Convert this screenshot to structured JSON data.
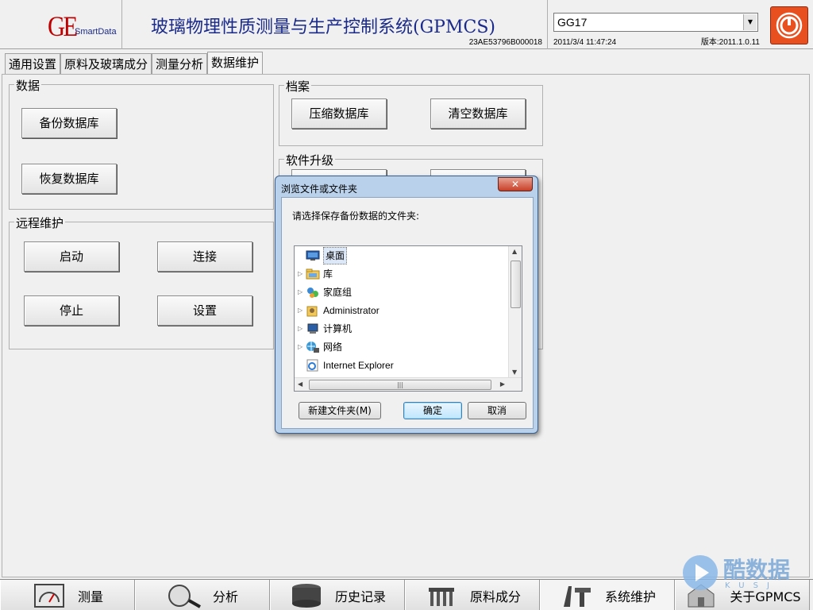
{
  "header": {
    "logo_main": "GE",
    "logo_sub": "SmartData",
    "title": "玻璃物理性质测量与生产控制系统(GPMCS)",
    "serial": "23AE53796B000018",
    "combo_value": "GG17",
    "datetime": "2011/3/4 11:47:24",
    "version": "版本:2011.1.0.11",
    "power_color": "#e85020"
  },
  "tabs": [
    {
      "label": "通用设置",
      "active": false
    },
    {
      "label": "原料及玻璃成分",
      "active": false
    },
    {
      "label": "测量分析",
      "active": false
    },
    {
      "label": "数据维护",
      "active": true
    }
  ],
  "groups": {
    "data": {
      "title": "数据",
      "backup": "备份数据库",
      "restore": "恢复数据库"
    },
    "archive": {
      "title": "档案",
      "compress": "压缩数据库",
      "clear": "清空数据库"
    },
    "upgrade": {
      "title": "软件升级"
    },
    "remote": {
      "title": "远程维护",
      "start": "启动",
      "connect": "连接",
      "stop": "停止",
      "settings": "设置"
    }
  },
  "dialog": {
    "title": "浏览文件或文件夹",
    "close": "✕",
    "prompt": "请选择保存备份数据的文件夹:",
    "tree": [
      {
        "label": "桌面",
        "icon": "desktop-icon",
        "expandable": false,
        "selected": true
      },
      {
        "label": "库",
        "icon": "library-icon",
        "expandable": true,
        "selected": false
      },
      {
        "label": "家庭组",
        "icon": "homegroup-icon",
        "expandable": true,
        "selected": false
      },
      {
        "label": "Administrator",
        "icon": "user-folder-icon",
        "expandable": true,
        "selected": false
      },
      {
        "label": "计算机",
        "icon": "computer-icon",
        "expandable": true,
        "selected": false
      },
      {
        "label": "网络",
        "icon": "network-icon",
        "expandable": true,
        "selected": false
      },
      {
        "label": "Internet Explorer",
        "icon": "ie-icon",
        "expandable": false,
        "selected": false
      }
    ],
    "new_folder": "新建文件夹(M)",
    "ok": "确定",
    "cancel": "取消"
  },
  "bottom_nav": [
    {
      "label": "测量",
      "icon": "gauge-icon",
      "active": false
    },
    {
      "label": "分析",
      "icon": "magnifier-icon",
      "active": false
    },
    {
      "label": "历史记录",
      "icon": "database-icon",
      "active": false
    },
    {
      "label": "原料成分",
      "icon": "ingredients-icon",
      "active": false
    },
    {
      "label": "系统维护",
      "icon": "tools-icon",
      "active": true
    },
    {
      "label": "关于GPMCS",
      "icon": "about-icon",
      "active": false
    }
  ],
  "watermark": {
    "text": "酷数据",
    "sub": "KUSJ"
  }
}
